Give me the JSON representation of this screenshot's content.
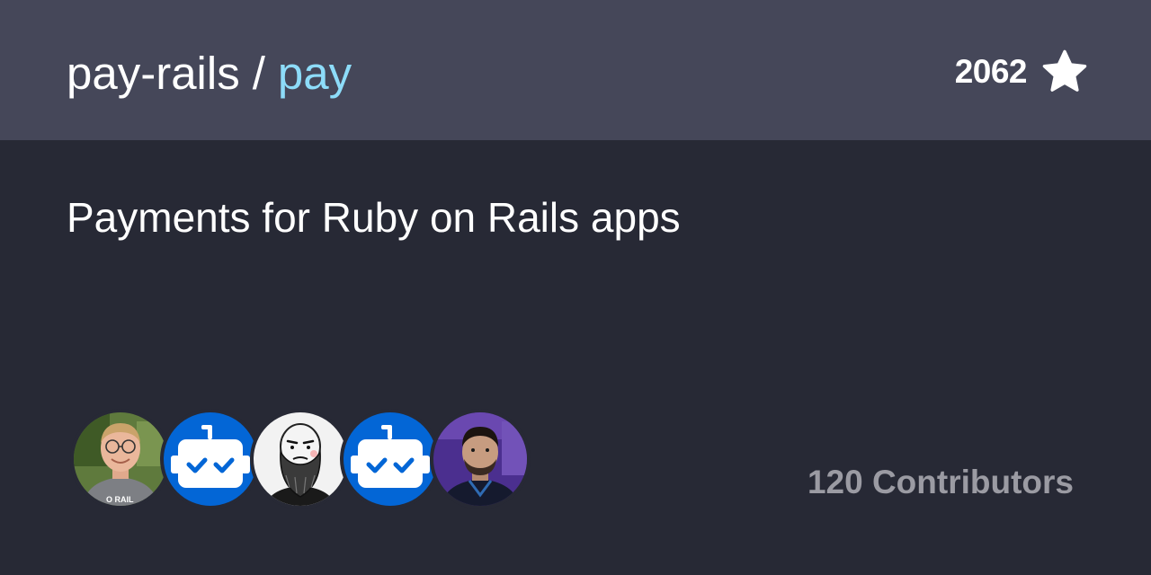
{
  "header": {
    "owner": "pay-rails",
    "separator": "/",
    "repo": "pay",
    "star_count": "2062",
    "star_icon": "star-icon"
  },
  "description": "Payments for Ruby on Rails apps",
  "contributors": {
    "label": "120 Contributors",
    "avatars": [
      "contributor-avatar-1",
      "bot-avatar",
      "contributor-avatar-2",
      "bot-avatar",
      "contributor-avatar-3"
    ]
  },
  "colors": {
    "header_bg": "#454759",
    "page_bg": "#272935",
    "repo_accent": "#8ddcf9",
    "muted_text": "#9b9ba3",
    "bot_blue": "#0366d6"
  }
}
